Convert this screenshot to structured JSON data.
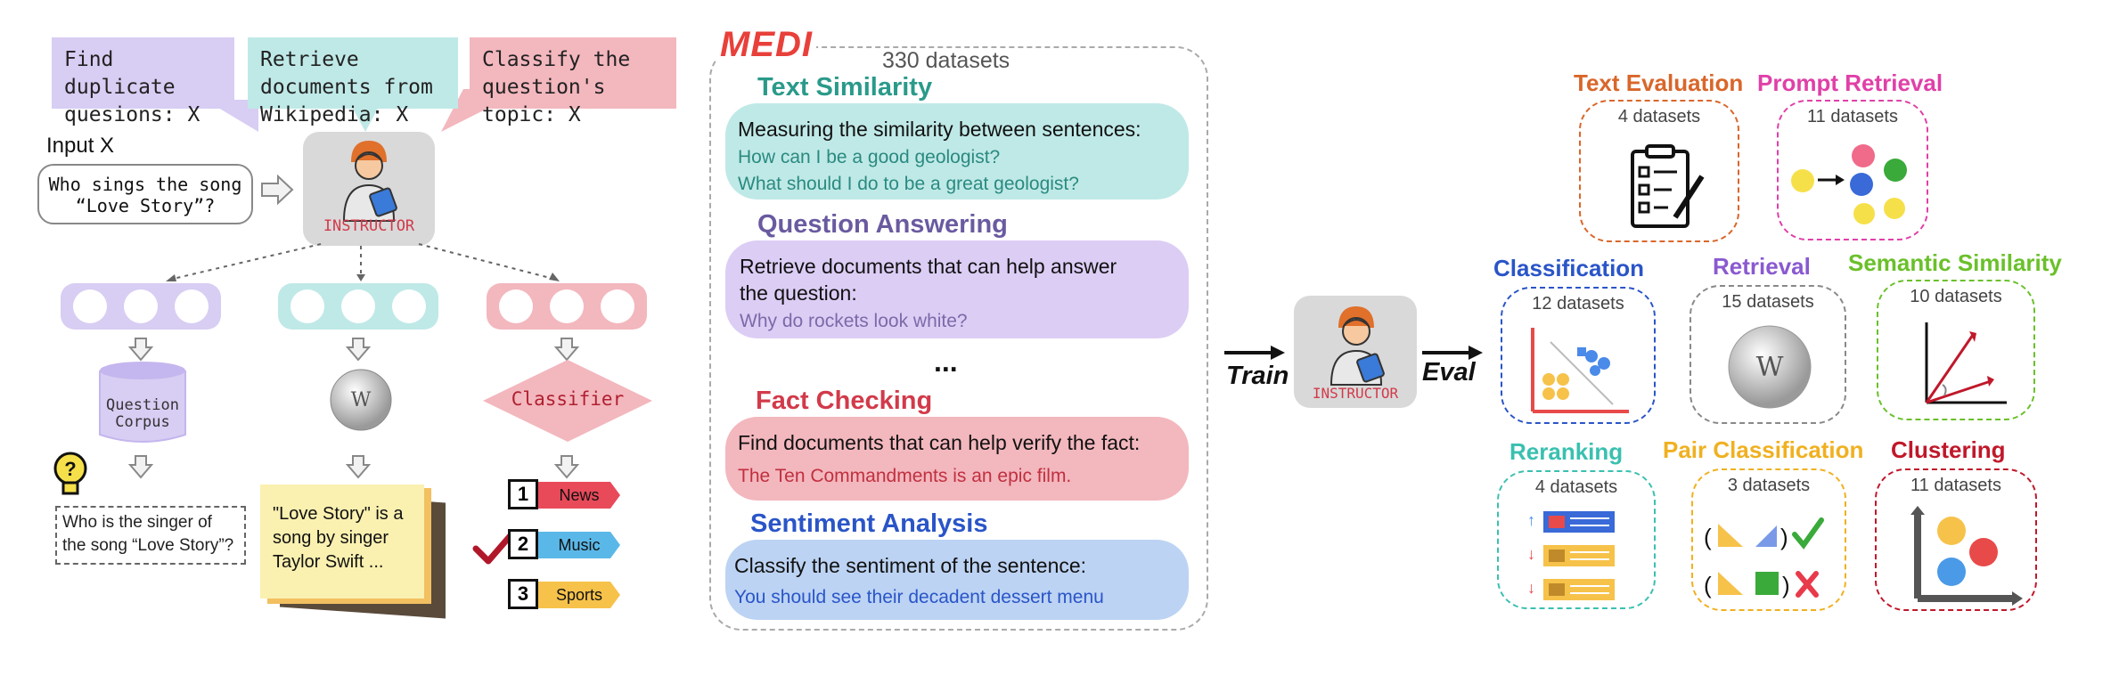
{
  "bubbles": [
    {
      "text": "Find duplicate quesions: X",
      "color": "#d8cdf3"
    },
    {
      "text": "Retrieve documents from Wikipedia: X",
      "color": "#bfe9e7"
    },
    {
      "text": "Classify the question's topic: X",
      "color": "#f3b7be"
    }
  ],
  "input_label": "Input X",
  "input_text": "Who sings the song “Love Story”?",
  "instructor_label": "INSTRUCTOR",
  "corpus_label": "Question Corpus",
  "output_duplicate": "Who is the singer of the song “Love Story”?",
  "output_note": "\"Love Story\" is a song by singer Taylor Swift ...",
  "classifier_label": "Classifier",
  "topics": [
    {
      "num": "1",
      "label": "News"
    },
    {
      "num": "2",
      "label": "Music"
    },
    {
      "num": "3",
      "label": "Sports"
    }
  ],
  "medi": {
    "logo": "MEDI",
    "count": "330 datasets",
    "ellipsis": "...",
    "tasks": [
      {
        "title": "Text Similarity",
        "instruction": "Measuring the similarity between sentences:",
        "example": "How can I be a good geologist?",
        "example2": "What should I do to be a great geologist?",
        "title_color": "#2a9a8a",
        "bg": "#bfe9e7",
        "example_color": "#2a8a80"
      },
      {
        "title": "Question Answering",
        "instruction": "Retrieve documents that can help answer the question:",
        "example": "Why do rockets look white?",
        "title_color": "#6a5aa0",
        "bg": "#dccdf5",
        "example_color": "#7a6aa8"
      },
      {
        "title": "Fact Checking",
        "instruction": "Find documents that can help verify the fact:",
        "example": "The Ten Commandments is an epic film.",
        "title_color": "#d23a4a",
        "bg": "#f3b7be",
        "example_color": "#c0303f"
      },
      {
        "title": "Sentiment Analysis",
        "instruction": "Classify the sentiment of the sentence:",
        "example": "You should see their decadent dessert menu",
        "title_color": "#2a55c8",
        "bg": "#bcd3f3",
        "example_color": "#2a55c8"
      }
    ]
  },
  "train_label": "Train",
  "eval_label": "Eval",
  "eval_tasks": [
    {
      "title": "Text Evaluation",
      "count": "4 datasets",
      "color": "#d9662a"
    },
    {
      "title": "Prompt Retrieval",
      "count": "11 datasets",
      "color": "#e040a8"
    },
    {
      "title": "Classification",
      "count": "12 datasets",
      "color": "#2a55c8"
    },
    {
      "title": "Retrieval",
      "count": "15 datasets",
      "color": "#8a5ad0"
    },
    {
      "title": "Semantic Similarity",
      "count": "10 datasets",
      "color": "#6ac02a"
    },
    {
      "title": "Reranking",
      "count": "4 datasets",
      "color": "#3ac0b0"
    },
    {
      "title": "Pair Classification",
      "count": "3 datasets",
      "color": "#f0b020"
    },
    {
      "title": "Clustering",
      "count": "11 datasets",
      "color": "#c0182a"
    }
  ]
}
